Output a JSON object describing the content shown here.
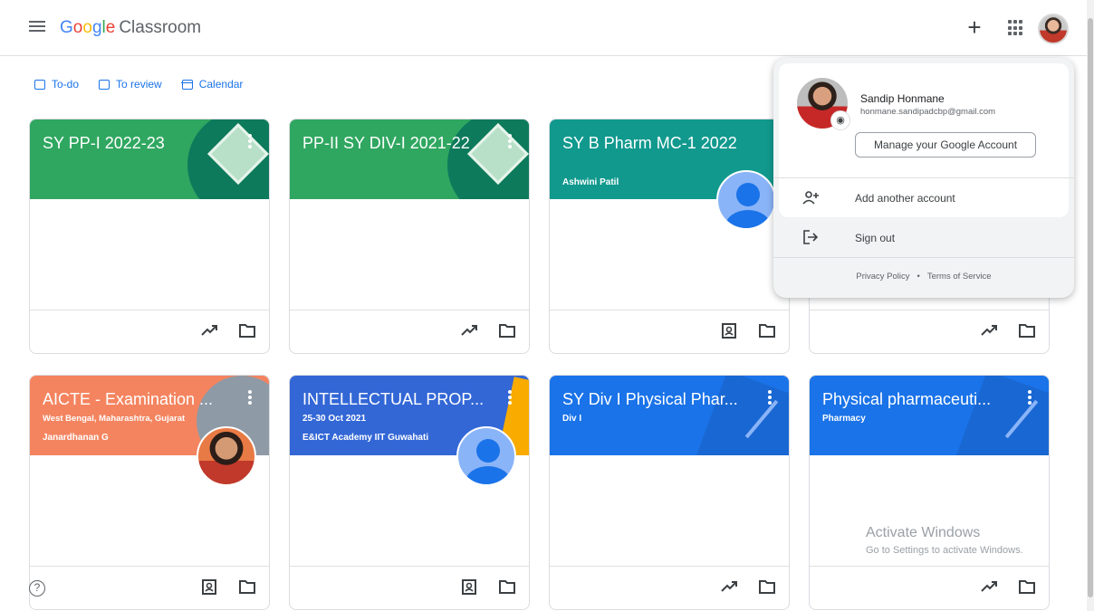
{
  "app": {
    "brand_google": "Google",
    "brand_product": "Classroom",
    "brand_letters": [
      "G",
      "o",
      "o",
      "g",
      "l",
      "e"
    ]
  },
  "header": {
    "create_icon": "plus-icon",
    "apps_icon": "apps-grid-icon",
    "plus_glyph": "+"
  },
  "subnav": {
    "todo": "To-do",
    "review": "To review",
    "calendar": "Calendar"
  },
  "cards": [
    {
      "title": "SY PP-I 2022-23",
      "subtitle": "",
      "teacher": "",
      "color": "#1e8e3e"
    },
    {
      "title": "PP-II SY DIV-I 2021-22",
      "subtitle": "",
      "teacher": "",
      "color": "#1e8e3e"
    },
    {
      "title": "SY B Pharm MC-1 2022",
      "subtitle": "Ashwini Patil",
      "teacher": "",
      "color": "#129eaf"
    },
    {
      "title": "AICTE - Examination ...",
      "subtitle": "West Bengal, Maharashtra, Gujarat",
      "teacher": "Janardhanan G",
      "color": "#e8710a"
    },
    {
      "title": "INTELLECTUAL PROP...",
      "subtitle": "25-30 Oct 2021",
      "teacher": "E&ICT Academy IIT Guwahati",
      "color": "#4285f4"
    },
    {
      "title": "SY Div I Physical Phar...",
      "subtitle": "Div I",
      "teacher": "",
      "color": "#1a73e8"
    },
    {
      "title": "Physical pharmaceuti...",
      "subtitle": "Pharmacy",
      "teacher": "",
      "color": "#1a73e8"
    }
  ],
  "account": {
    "name": "Sandip Honmane",
    "email": "honmane.sandipadcbp@gmail.com",
    "manage": "Manage your Google Account",
    "add_account": "Add another account",
    "sign_out": "Sign out",
    "privacy": "Privacy Policy",
    "dot": "•",
    "terms": "Terms of Service"
  },
  "watermark": {
    "line1": "Activate Windows",
    "line2": "Go to Settings to activate Windows."
  },
  "help_glyph": "?",
  "colors": {
    "accent": "#1a73e8",
    "green_card": "#1e8e3e",
    "teal_card": "#129eaf",
    "orange_card": "#f28b5b",
    "blue_card": "#1a73e8",
    "indigo_card": "#3367d6"
  }
}
